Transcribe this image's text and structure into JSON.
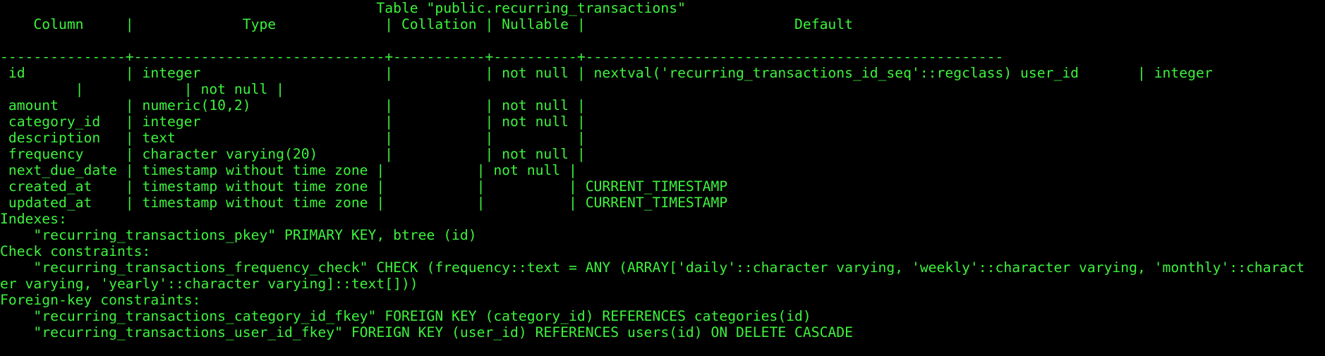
{
  "terminal": {
    "text_color": "#3df23d",
    "background_color": "#000000",
    "lines": [
      "                                             Table \"public.recurring_transactions\"",
      "    Column     |             Type             | Collation | Nullable |                         Default",
      "",
      "---------------+------------------------------+-----------+----------+--------------------------------------------------",
      " id            | integer                      |           | not null | nextval('recurring_transactions_id_seq'::regclass) user_id       | integer",
      "         |            | not null |",
      " amount        | numeric(10,2)                |           | not null |",
      " category_id   | integer                      |           | not null |",
      " description   | text                         |           |          |",
      " frequency     | character varying(20)        |           | not null |",
      " next_due_date | timestamp without time zone |           | not null |",
      " created_at    | timestamp without time zone |           |          | CURRENT_TIMESTAMP",
      " updated_at    | timestamp without time zone |           |          | CURRENT_TIMESTAMP",
      "Indexes:",
      "    \"recurring_transactions_pkey\" PRIMARY KEY, btree (id)",
      "Check constraints:",
      "    \"recurring_transactions_frequency_check\" CHECK (frequency::text = ANY (ARRAY['daily'::character varying, 'weekly'::character varying, 'monthly'::charact",
      "er varying, 'yearly'::character varying]::text[]))",
      "Foreign-key constraints:",
      "    \"recurring_transactions_category_id_fkey\" FOREIGN KEY (category_id) REFERENCES categories(id)",
      "    \"recurring_transactions_user_id_fkey\" FOREIGN KEY (user_id) REFERENCES users(id) ON DELETE CASCADE"
    ]
  }
}
